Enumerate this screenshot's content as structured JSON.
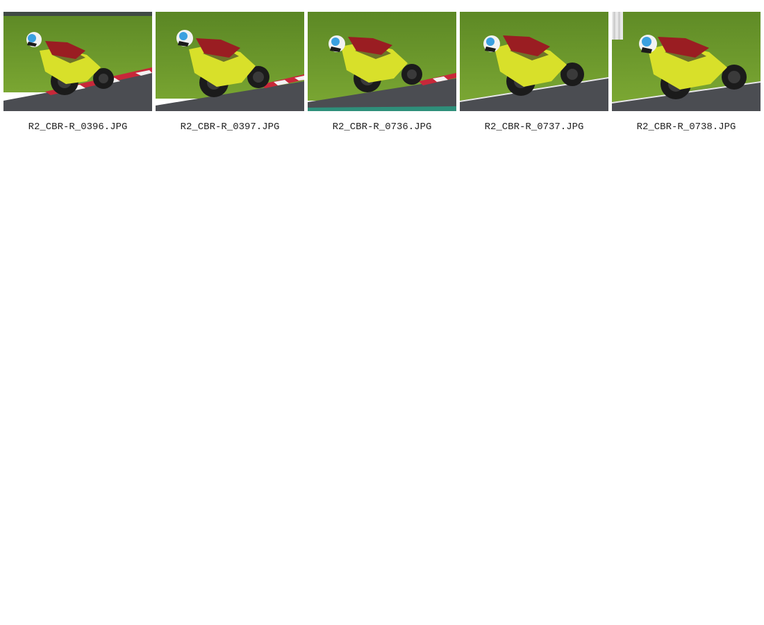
{
  "gallery": {
    "items": [
      {
        "filename": "R2_CBR-R_0396.JPG",
        "scene": "motorcycle-racer-cornering"
      },
      {
        "filename": "R2_CBR-R_0397.JPG",
        "scene": "motorcycle-racer-cornering"
      },
      {
        "filename": "R2_CBR-R_0736.JPG",
        "scene": "motorcycle-racer-cornering"
      },
      {
        "filename": "R2_CBR-R_0737.JPG",
        "scene": "motorcycle-racer-cornering"
      },
      {
        "filename": "R2_CBR-R_0738.JPG",
        "scene": "motorcycle-racer-cornering"
      }
    ]
  },
  "colors": {
    "grass": "#6f9a2c",
    "asphalt": "#4b4d52",
    "bike": "#d8e02a",
    "kerb_red": "#c8283a",
    "kerb_white": "#f2f2f2",
    "helmet_blue": "#3aa0e0",
    "leathers_red": "#9a1d22"
  }
}
